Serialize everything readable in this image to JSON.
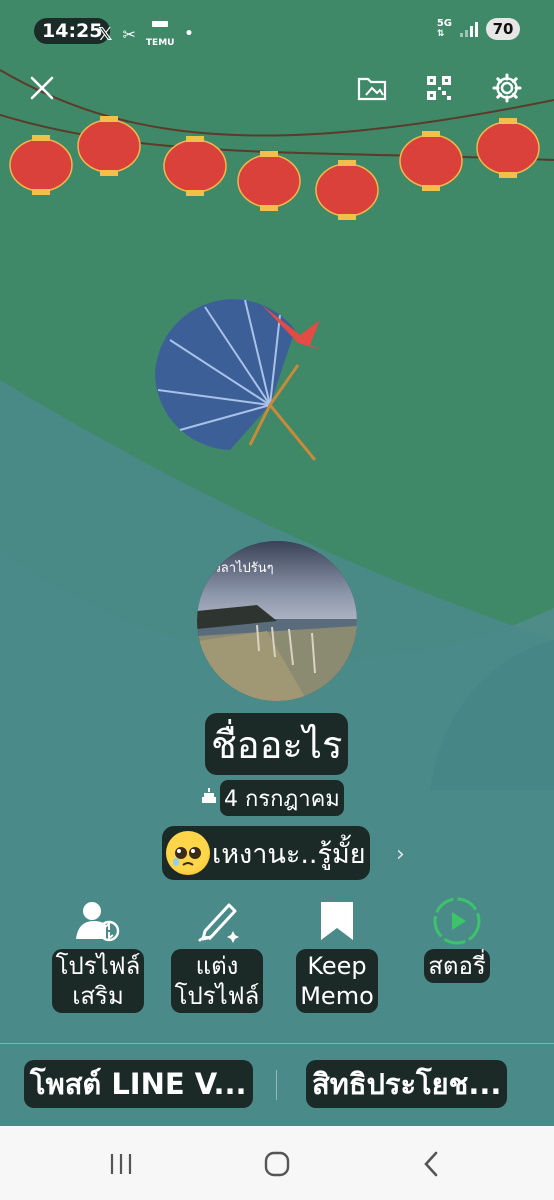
{
  "status_bar": {
    "time": "14:25",
    "temu_label": "TEMU",
    "network": "5G",
    "battery": "70"
  },
  "profile": {
    "avatar_caption": "เวลาไปรันๆ",
    "name": "ชื่ออะไร",
    "birthday": "4 กรกฎาคม",
    "status_message": "เหงานะ..รู้มั้ย"
  },
  "actions": [
    {
      "label": "โปรไฟล์\nเสริม",
      "icon": "profile-switch-icon"
    },
    {
      "label": "แต่ง\nโปรไฟล์",
      "icon": "edit-pen-icon"
    },
    {
      "label": "Keep\nMemo",
      "icon": "bookmark-icon"
    },
    {
      "label": "สตอรี่",
      "icon": "story-play-icon"
    }
  ],
  "tabs": [
    {
      "label": "โพสต์ LINE V..."
    },
    {
      "label": "สิทธิประโยช..."
    }
  ],
  "colors": {
    "background": "#4e8c87",
    "top_curve": "#3f8868",
    "pill_bg": "#1c2a27",
    "lantern": "#d9413a",
    "story_green": "#3cc46a",
    "fan_blue": "#3c5f98"
  }
}
